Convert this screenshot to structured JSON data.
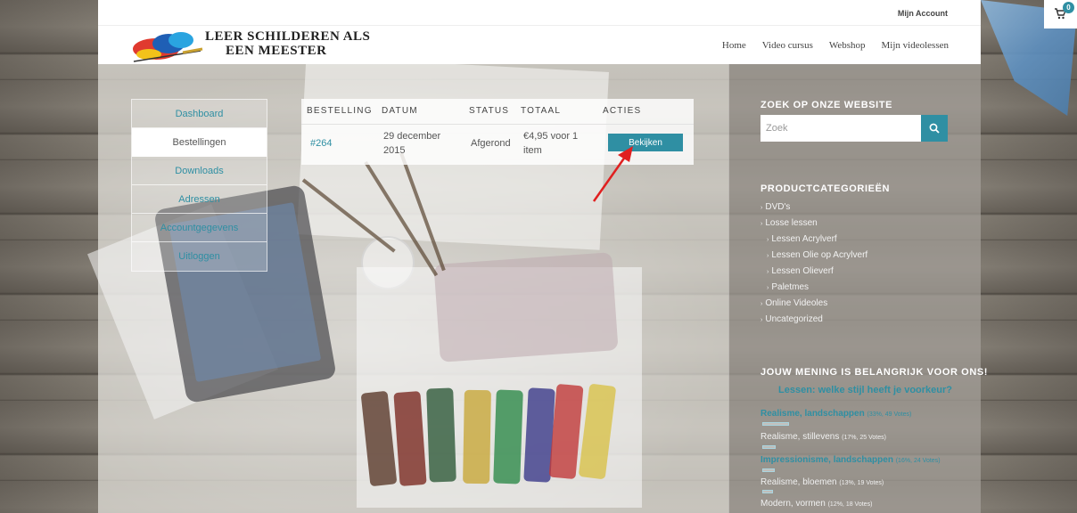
{
  "header": {
    "top_link": "Mijn Account",
    "logo_line1": "LEER SCHILDEREN ALS",
    "logo_line2": "EEN MEESTER",
    "nav": [
      "Home",
      "Video cursus",
      "Webshop",
      "Mijn videolessen"
    ],
    "cart_count": "0"
  },
  "account_nav": {
    "items": [
      "Dashboard",
      "Bestellingen",
      "Downloads",
      "Adressen",
      "Accountgegevens",
      "Uitloggen"
    ],
    "active": "Bestellingen"
  },
  "orders": {
    "headers": [
      "BESTELLING",
      "DATUM",
      "STATUS",
      "TOTAAL",
      "ACTIES"
    ],
    "rows": [
      {
        "order": "#264",
        "date_line1": "29 december",
        "date_line2": "2015",
        "status": "Afgerond",
        "total_line1": "€4,95 voor 1",
        "total_line2": "item",
        "action": "Bekijken"
      }
    ]
  },
  "sidebar": {
    "search_title": "ZOEK OP ONZE WEBSITE",
    "search_placeholder": "Zoek",
    "categories_title": "PRODUCTCATEGORIEËN",
    "categories": [
      {
        "label": "DVD's",
        "level": 0
      },
      {
        "label": "Losse lessen",
        "level": 0
      },
      {
        "label": "Lessen Acrylverf",
        "level": 1
      },
      {
        "label": "Lessen Olie op Acrylverf",
        "level": 1
      },
      {
        "label": "Lessen Olieverf",
        "level": 1
      },
      {
        "label": "Paletmes",
        "level": 1
      },
      {
        "label": "Online Videoles",
        "level": 0
      },
      {
        "label": "Uncategorized",
        "level": 0
      }
    ],
    "poll_title": "JOUW MENING IS BELANGRIJK VOOR ONS!",
    "poll_question": "Lessen: welke stijl heeft je voorkeur?",
    "poll_options": [
      {
        "label": "Realisme, landschappen",
        "meta": "(33%, 49 Votes)",
        "highlight": true,
        "percent": 33
      },
      {
        "label": "Realisme, stillevens",
        "meta": "(17%, 25 Votes)",
        "highlight": false,
        "percent": 17
      },
      {
        "label": "Impressionisme, landschappen",
        "meta": "(16%, 24 Votes)",
        "highlight": true,
        "percent": 16
      },
      {
        "label": "Realisme, bloemen",
        "meta": "(13%, 19 Votes)",
        "highlight": false,
        "percent": 13
      },
      {
        "label": "Modern, vormen",
        "meta": "(12%, 18 Votes)",
        "highlight": false,
        "percent": 12
      }
    ]
  },
  "colors": {
    "accent": "#2f8fa3",
    "annotation_arrow": "#e02020"
  }
}
